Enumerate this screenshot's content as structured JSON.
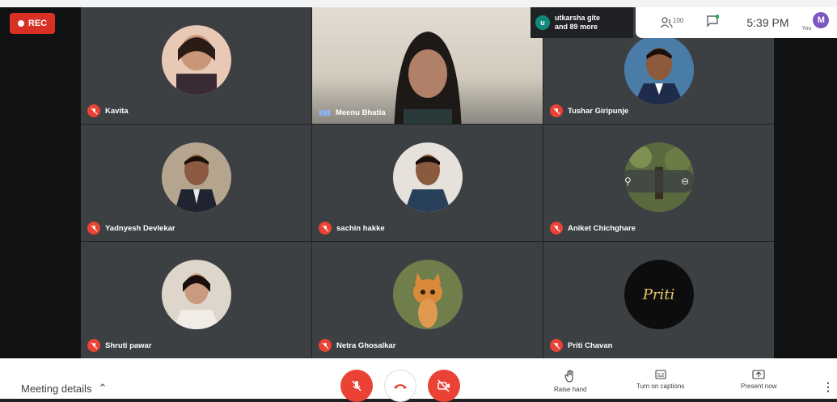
{
  "recording": {
    "label": "REC"
  },
  "participants_overlay": {
    "avatar_letter": "u",
    "line1": "utkarsha gite",
    "line2": "and 89 more"
  },
  "topbar": {
    "people_count": "100",
    "time": "5:39 PM",
    "you_label": "You",
    "avatar_letter": "M"
  },
  "tiles": [
    {
      "name": "Kavita"
    },
    {
      "name": "Meenu Bhatia"
    },
    {
      "name": "Tushar Giripunje"
    },
    {
      "name": "Yadnyesh Devlekar"
    },
    {
      "name": "sachin hakke"
    },
    {
      "name": "Aniket Chichghare"
    },
    {
      "name": "Shruti pawar"
    },
    {
      "name": "Netra Ghosalkar"
    },
    {
      "name": "Priti Chavan"
    }
  ],
  "priti_logo_text": "Priti",
  "bottombar": {
    "meeting_details": "Meeting details",
    "raise_hand": "Raise hand",
    "captions": "Turn on captions",
    "present": "Present now"
  },
  "colors": {
    "danger": "#ea4335",
    "rec": "#d93025",
    "tile": "#3c4043",
    "accent": "#7e57c2"
  }
}
